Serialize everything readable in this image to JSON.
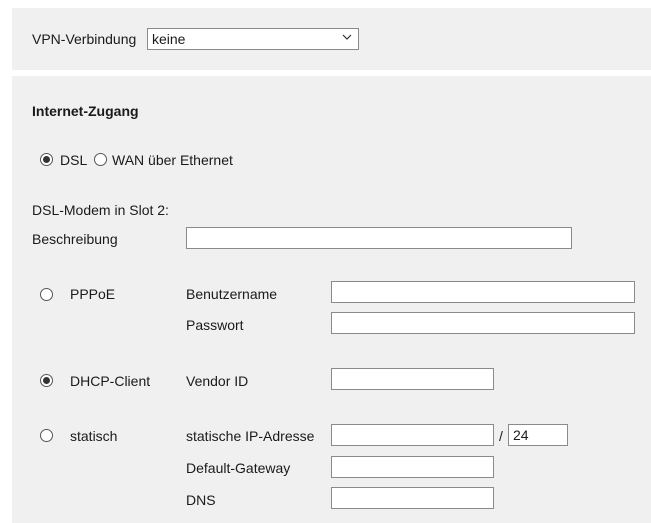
{
  "vpn": {
    "label": "VPN-Verbindung",
    "selected": "keine"
  },
  "internet": {
    "heading": "Internet-Zugang",
    "mode_dsl": "DSL",
    "mode_wan": "WAN über Ethernet",
    "modem_label": "DSL-Modem in Slot 2:",
    "description_label": "Beschreibung",
    "description_value": ""
  },
  "pppoe": {
    "label": "PPPoE",
    "username_label": "Benutzername",
    "username_value": "",
    "password_label": "Passwort",
    "password_value": ""
  },
  "dhcp": {
    "label": "DHCP-Client",
    "vendor_label": "Vendor ID",
    "vendor_value": ""
  },
  "static": {
    "label": "statisch",
    "ip_label": "statische IP-Adresse",
    "ip_value": "",
    "prefix_sep": "/",
    "prefix_value": "24",
    "gateway_label": "Default-Gateway",
    "gateway_value": "",
    "dns_label": "DNS",
    "dns_value": ""
  },
  "selected_mode": "DSL",
  "selected_connection": "DHCP-Client"
}
